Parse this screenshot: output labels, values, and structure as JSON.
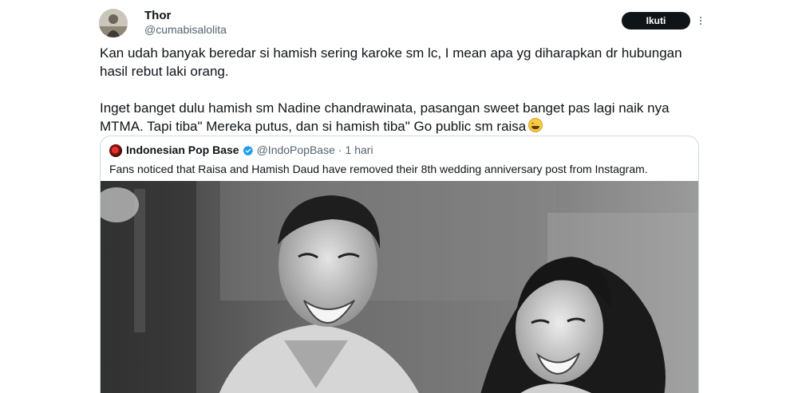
{
  "tweet": {
    "author_name": "Thor",
    "author_handle": "@cumabisalolita",
    "follow_label": "Ikuti",
    "paragraph_1": "Kan udah banyak beredar si hamish sering karoke sm lc, I mean apa yg diharapkan dr hubungan hasil rebut laki orang.",
    "paragraph_2": "Inget banget dulu hamish sm Nadine chandrawinata, pasangan sweet banget pas lagi naik nya MTMA. Tapi tiba\" Mereka putus, dan si hamish tiba\" Go public sm raisa",
    "emoji_icon": "grinning-sweat-emoji"
  },
  "quote": {
    "name": "Indonesian Pop Base",
    "handle": "@IndoPopBase",
    "separator": "·",
    "time": "1 hari",
    "text": "Fans noticed that Raisa and Hamish Daud have removed their 8th wedding anniversary post from Instagram.",
    "verified_icon": "verified-badge-icon",
    "photo_icon": "black-and-white-couple-photo"
  },
  "colors": {
    "text": "#0f1419",
    "secondary": "#536471",
    "border": "#cfd9de",
    "verified": "#1d9bf0",
    "button_bg": "#0f1419"
  }
}
